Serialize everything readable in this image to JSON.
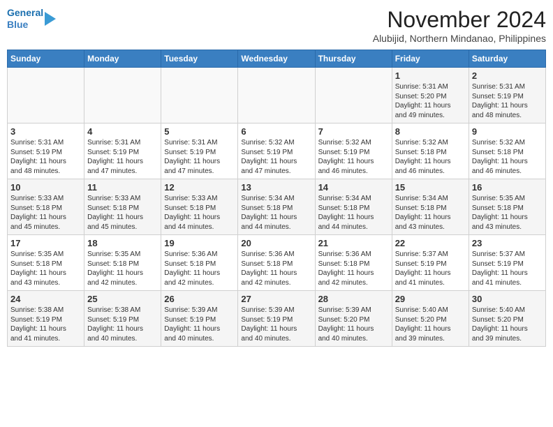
{
  "header": {
    "logo_line1": "General",
    "logo_line2": "Blue",
    "month": "November 2024",
    "location": "Alubijid, Northern Mindanao, Philippines"
  },
  "weekdays": [
    "Sunday",
    "Monday",
    "Tuesday",
    "Wednesday",
    "Thursday",
    "Friday",
    "Saturday"
  ],
  "weeks": [
    [
      {
        "day": "",
        "info": ""
      },
      {
        "day": "",
        "info": ""
      },
      {
        "day": "",
        "info": ""
      },
      {
        "day": "",
        "info": ""
      },
      {
        "day": "",
        "info": ""
      },
      {
        "day": "1",
        "info": "Sunrise: 5:31 AM\nSunset: 5:20 PM\nDaylight: 11 hours\nand 49 minutes."
      },
      {
        "day": "2",
        "info": "Sunrise: 5:31 AM\nSunset: 5:19 PM\nDaylight: 11 hours\nand 48 minutes."
      }
    ],
    [
      {
        "day": "3",
        "info": "Sunrise: 5:31 AM\nSunset: 5:19 PM\nDaylight: 11 hours\nand 48 minutes."
      },
      {
        "day": "4",
        "info": "Sunrise: 5:31 AM\nSunset: 5:19 PM\nDaylight: 11 hours\nand 47 minutes."
      },
      {
        "day": "5",
        "info": "Sunrise: 5:31 AM\nSunset: 5:19 PM\nDaylight: 11 hours\nand 47 minutes."
      },
      {
        "day": "6",
        "info": "Sunrise: 5:32 AM\nSunset: 5:19 PM\nDaylight: 11 hours\nand 47 minutes."
      },
      {
        "day": "7",
        "info": "Sunrise: 5:32 AM\nSunset: 5:19 PM\nDaylight: 11 hours\nand 46 minutes."
      },
      {
        "day": "8",
        "info": "Sunrise: 5:32 AM\nSunset: 5:18 PM\nDaylight: 11 hours\nand 46 minutes."
      },
      {
        "day": "9",
        "info": "Sunrise: 5:32 AM\nSunset: 5:18 PM\nDaylight: 11 hours\nand 46 minutes."
      }
    ],
    [
      {
        "day": "10",
        "info": "Sunrise: 5:33 AM\nSunset: 5:18 PM\nDaylight: 11 hours\nand 45 minutes."
      },
      {
        "day": "11",
        "info": "Sunrise: 5:33 AM\nSunset: 5:18 PM\nDaylight: 11 hours\nand 45 minutes."
      },
      {
        "day": "12",
        "info": "Sunrise: 5:33 AM\nSunset: 5:18 PM\nDaylight: 11 hours\nand 44 minutes."
      },
      {
        "day": "13",
        "info": "Sunrise: 5:34 AM\nSunset: 5:18 PM\nDaylight: 11 hours\nand 44 minutes."
      },
      {
        "day": "14",
        "info": "Sunrise: 5:34 AM\nSunset: 5:18 PM\nDaylight: 11 hours\nand 44 minutes."
      },
      {
        "day": "15",
        "info": "Sunrise: 5:34 AM\nSunset: 5:18 PM\nDaylight: 11 hours\nand 43 minutes."
      },
      {
        "day": "16",
        "info": "Sunrise: 5:35 AM\nSunset: 5:18 PM\nDaylight: 11 hours\nand 43 minutes."
      }
    ],
    [
      {
        "day": "17",
        "info": "Sunrise: 5:35 AM\nSunset: 5:18 PM\nDaylight: 11 hours\nand 43 minutes."
      },
      {
        "day": "18",
        "info": "Sunrise: 5:35 AM\nSunset: 5:18 PM\nDaylight: 11 hours\nand 42 minutes."
      },
      {
        "day": "19",
        "info": "Sunrise: 5:36 AM\nSunset: 5:18 PM\nDaylight: 11 hours\nand 42 minutes."
      },
      {
        "day": "20",
        "info": "Sunrise: 5:36 AM\nSunset: 5:18 PM\nDaylight: 11 hours\nand 42 minutes."
      },
      {
        "day": "21",
        "info": "Sunrise: 5:36 AM\nSunset: 5:18 PM\nDaylight: 11 hours\nand 42 minutes."
      },
      {
        "day": "22",
        "info": "Sunrise: 5:37 AM\nSunset: 5:19 PM\nDaylight: 11 hours\nand 41 minutes."
      },
      {
        "day": "23",
        "info": "Sunrise: 5:37 AM\nSunset: 5:19 PM\nDaylight: 11 hours\nand 41 minutes."
      }
    ],
    [
      {
        "day": "24",
        "info": "Sunrise: 5:38 AM\nSunset: 5:19 PM\nDaylight: 11 hours\nand 41 minutes."
      },
      {
        "day": "25",
        "info": "Sunrise: 5:38 AM\nSunset: 5:19 PM\nDaylight: 11 hours\nand 40 minutes."
      },
      {
        "day": "26",
        "info": "Sunrise: 5:39 AM\nSunset: 5:19 PM\nDaylight: 11 hours\nand 40 minutes."
      },
      {
        "day": "27",
        "info": "Sunrise: 5:39 AM\nSunset: 5:19 PM\nDaylight: 11 hours\nand 40 minutes."
      },
      {
        "day": "28",
        "info": "Sunrise: 5:39 AM\nSunset: 5:20 PM\nDaylight: 11 hours\nand 40 minutes."
      },
      {
        "day": "29",
        "info": "Sunrise: 5:40 AM\nSunset: 5:20 PM\nDaylight: 11 hours\nand 39 minutes."
      },
      {
        "day": "30",
        "info": "Sunrise: 5:40 AM\nSunset: 5:20 PM\nDaylight: 11 hours\nand 39 minutes."
      }
    ]
  ]
}
